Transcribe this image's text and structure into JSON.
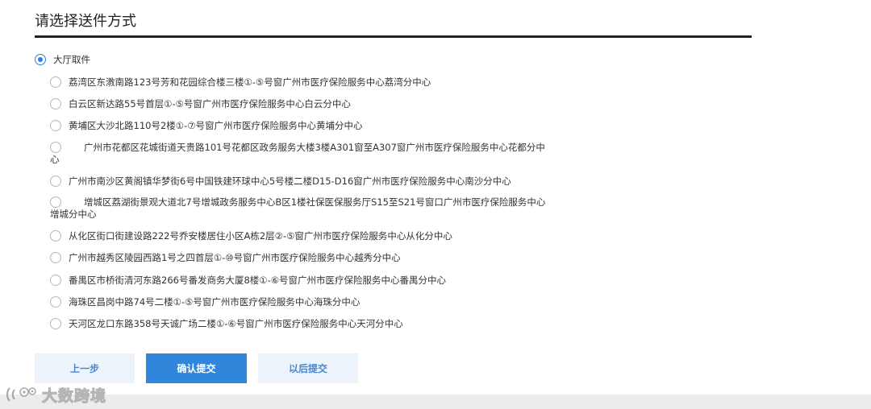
{
  "page": {
    "title": "请选择送件方式"
  },
  "options": [
    {
      "label": "大厅取件",
      "selected": true
    },
    {
      "label": "荔湾区东漖南路123号芳和花园综合楼三楼①-⑤号窗广州市医疗保险服务中心荔湾分中心",
      "selected": false
    },
    {
      "label": "白云区新达路55号首层①-⑤号窗广州市医疗保险服务中心白云分中心",
      "selected": false
    },
    {
      "label": "黄埔区大沙北路110号2楼①-⑦号窗广州市医疗保险服务中心黄埔分中心",
      "selected": false
    },
    {
      "label": "广州市花都区花城街道天贵路101号花都区政务服务大楼3楼A301窗至A307窗广州市医疗保险服务中心花都分中心",
      "selected": false
    },
    {
      "label": "广州市南沙区黄阁镇华梦街6号中国铁建环球中心5号楼二楼D15-D16窗广州市医疗保险服务中心南沙分中心",
      "selected": false
    },
    {
      "label": "增城区荔湖街景观大道北7号增城政务服务中心B区1楼社保医保服务厅S15至S21号窗口广州市医疗保险服务中心增城分中心",
      "selected": false
    },
    {
      "label": "从化区街口街建设路222号乔安楼居住小区A栋2层②-⑤窗广州市医疗保险服务中心从化分中心",
      "selected": false
    },
    {
      "label": "广州市越秀区陵园西路1号之四首层①-⑩号窗广州市医疗保险服务中心越秀分中心",
      "selected": false
    },
    {
      "label": "番禺区市桥街清河东路266号番发商务大厦8楼①-⑥号窗广州市医疗保险服务中心番禺分中心",
      "selected": false
    },
    {
      "label": "海珠区昌岗中路74号二楼①-⑤号窗广州市医疗保险服务中心海珠分中心",
      "selected": false
    },
    {
      "label": "天河区龙口东路358号天诚广场二楼①-⑥号窗广州市医疗保险服务中心天河分中心",
      "selected": false
    }
  ],
  "buttons": {
    "prev": "上一步",
    "confirm": "确认提交",
    "later": "以后提交"
  },
  "watermark": {
    "text": "大数跨境"
  },
  "colors": {
    "accent": "#2f86da",
    "secondary_button_bg": "#edf3fa",
    "title_rule": "#222222"
  }
}
